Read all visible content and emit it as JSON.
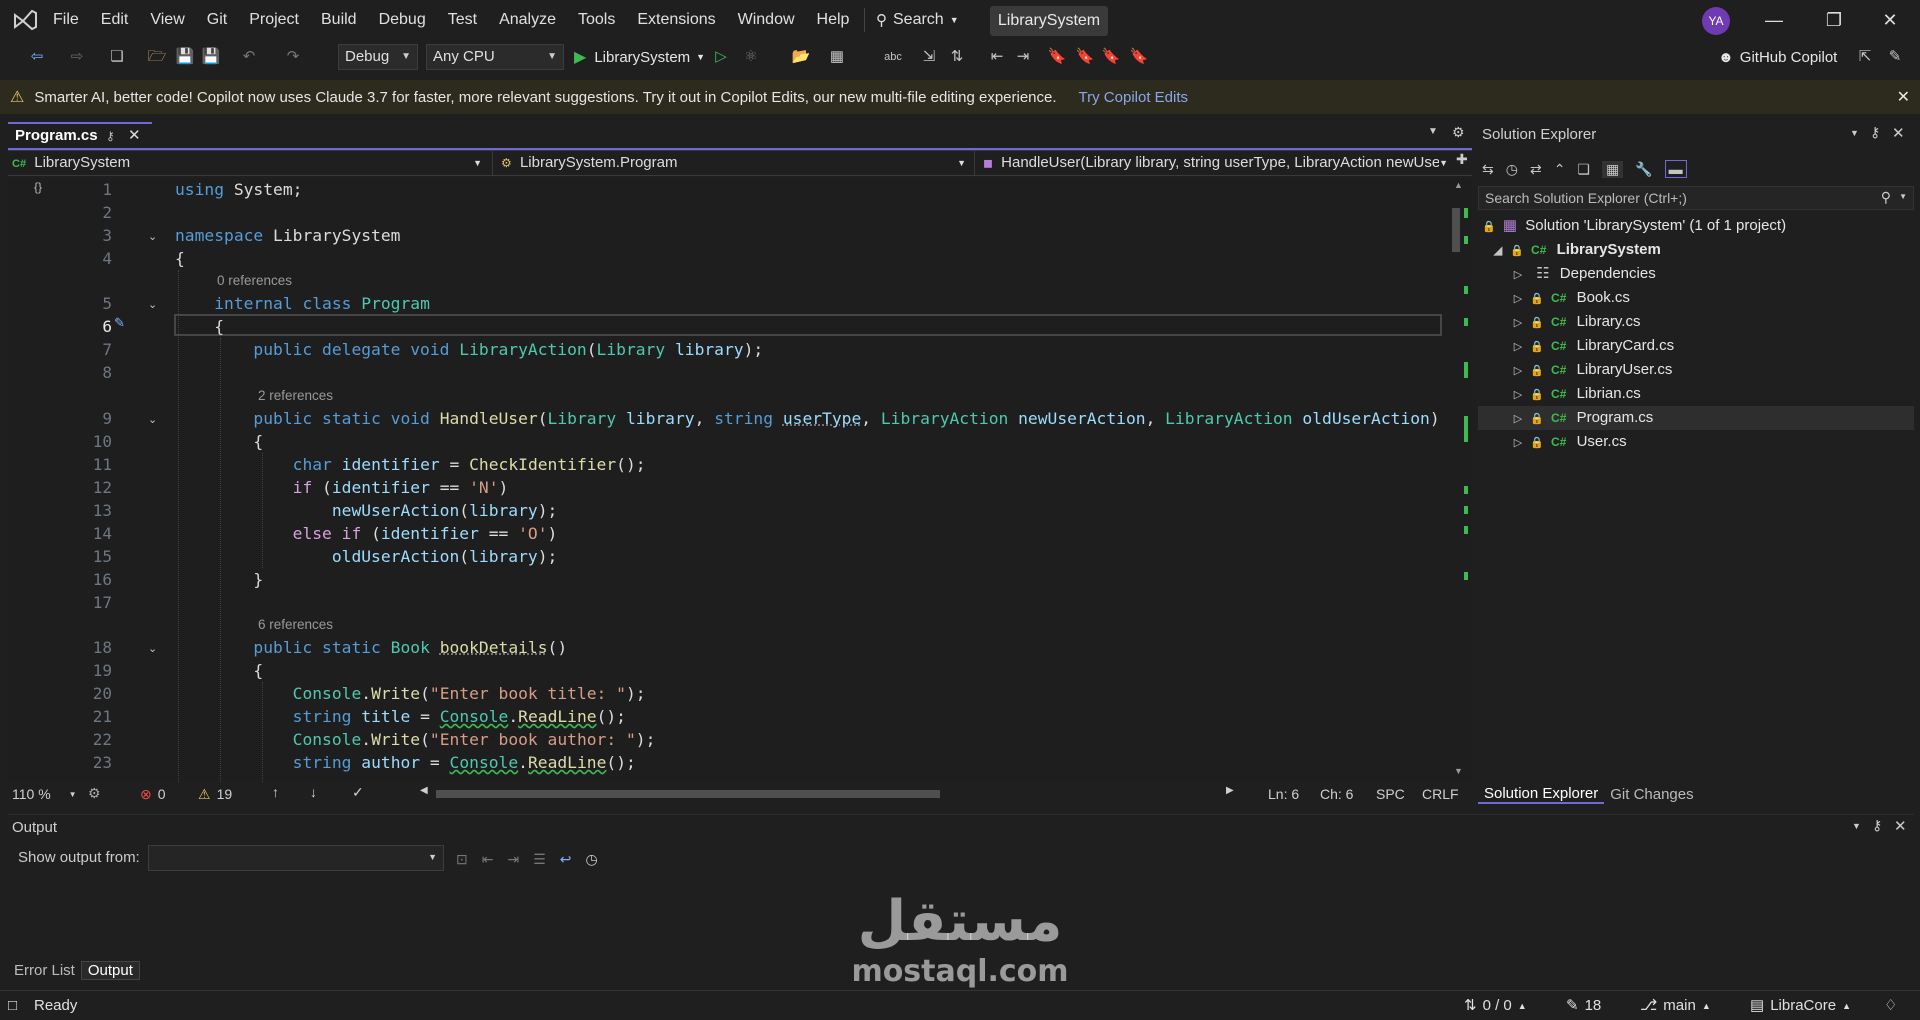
{
  "titlebar": {
    "menu": [
      "File",
      "Edit",
      "View",
      "Git",
      "Project",
      "Build",
      "Debug",
      "Test",
      "Analyze",
      "Tools",
      "Extensions",
      "Window",
      "Help"
    ],
    "search_label": "Search",
    "project_name": "LibrarySystem",
    "avatar_initials": "YA"
  },
  "toolbar": {
    "configuration": "Debug",
    "platform": "Any CPU",
    "run_target": "LibrarySystem",
    "copilot_label": "GitHub Copilot"
  },
  "banner": {
    "message": "Smarter AI, better code! Copilot now uses Claude 3.7 for faster, more relevant suggestions. Try it out in Copilot Edits, our new multi-file editing experience.",
    "link": "Try Copilot Edits"
  },
  "editor": {
    "tab": "Program.cs",
    "nav_project": "LibrarySystem",
    "nav_class": "LibrarySystem.Program",
    "nav_member": "HandleUser(Library library, string userType, LibraryAction newUser",
    "codelens": {
      "l5": "0 references",
      "l9": "2 references",
      "l18": "6 references"
    },
    "zoom": "110 %",
    "errors": "0",
    "warnings": "19",
    "ln": "Ln: 6",
    "ch": "Ch: 6",
    "spc": "SPC",
    "eol": "CRLF"
  },
  "solution_explorer": {
    "title": "Solution Explorer",
    "search_placeholder": "Search Solution Explorer (Ctrl+;)",
    "solution": "Solution 'LibrarySystem' (1 of 1 project)",
    "project": "LibrarySystem",
    "dependencies": "Dependencies",
    "files": [
      "Book.cs",
      "Library.cs",
      "LibraryCard.cs",
      "LibraryUser.cs",
      "Librian.cs",
      "Program.cs",
      "User.cs"
    ],
    "selected_file": "Program.cs",
    "bottom_tabs": [
      "Solution Explorer",
      "Git Changes"
    ]
  },
  "output": {
    "title": "Output",
    "show_from_label": "Show output from:",
    "tabs": [
      "Error List",
      "Output"
    ]
  },
  "statusbar": {
    "ready": "Ready",
    "sync": "0 / 0",
    "edits": "18",
    "branch": "main",
    "repo": "LibraCore"
  },
  "watermark": {
    "arabic": "مستقل",
    "latin": "mostaql.com"
  },
  "colors": {
    "accent": "#6f6ad8",
    "keyword": "#569cd6",
    "type": "#4ec9b0",
    "method": "#dcdcaa",
    "string": "#d69d85",
    "param": "#9cdcfe",
    "banner_bg": "#2d2a1e",
    "link": "#8aa8e8"
  }
}
